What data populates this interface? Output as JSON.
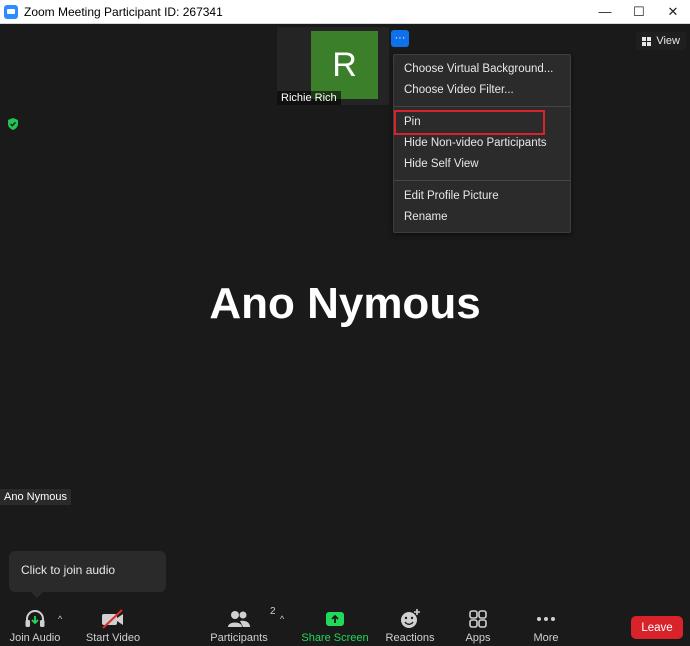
{
  "window": {
    "title": "Zoom Meeting Participant ID: 267341",
    "minimize": "—",
    "maximize": "☐",
    "close": "✕"
  },
  "thumbnail": {
    "initial": "R",
    "name": "Richie Rich",
    "avatar_color": "#3b7f2b"
  },
  "more_button": "···",
  "view_button": "View",
  "menu": {
    "group1": [
      "Choose Virtual Background...",
      "Choose Video Filter..."
    ],
    "group2": [
      "Pin",
      "Hide Non-video Participants",
      "Hide Self View"
    ],
    "group3": [
      "Edit Profile Picture",
      "Rename"
    ]
  },
  "active_speaker": "Ano Nymous",
  "self_label": "Ano Nymous",
  "tooltip": "Click to join audio",
  "toolbar": {
    "join_audio": "Join Audio",
    "start_video": "Start Video",
    "participants": "Participants",
    "participants_count": "2",
    "share_screen": "Share Screen",
    "reactions": "Reactions",
    "apps": "Apps",
    "more": "More",
    "leave": "Leave",
    "caret": "^"
  },
  "colors": {
    "accent_blue": "#0e71eb",
    "share_green": "#23d959",
    "leave_red": "#d9232a",
    "highlight_red": "#d9232a"
  }
}
